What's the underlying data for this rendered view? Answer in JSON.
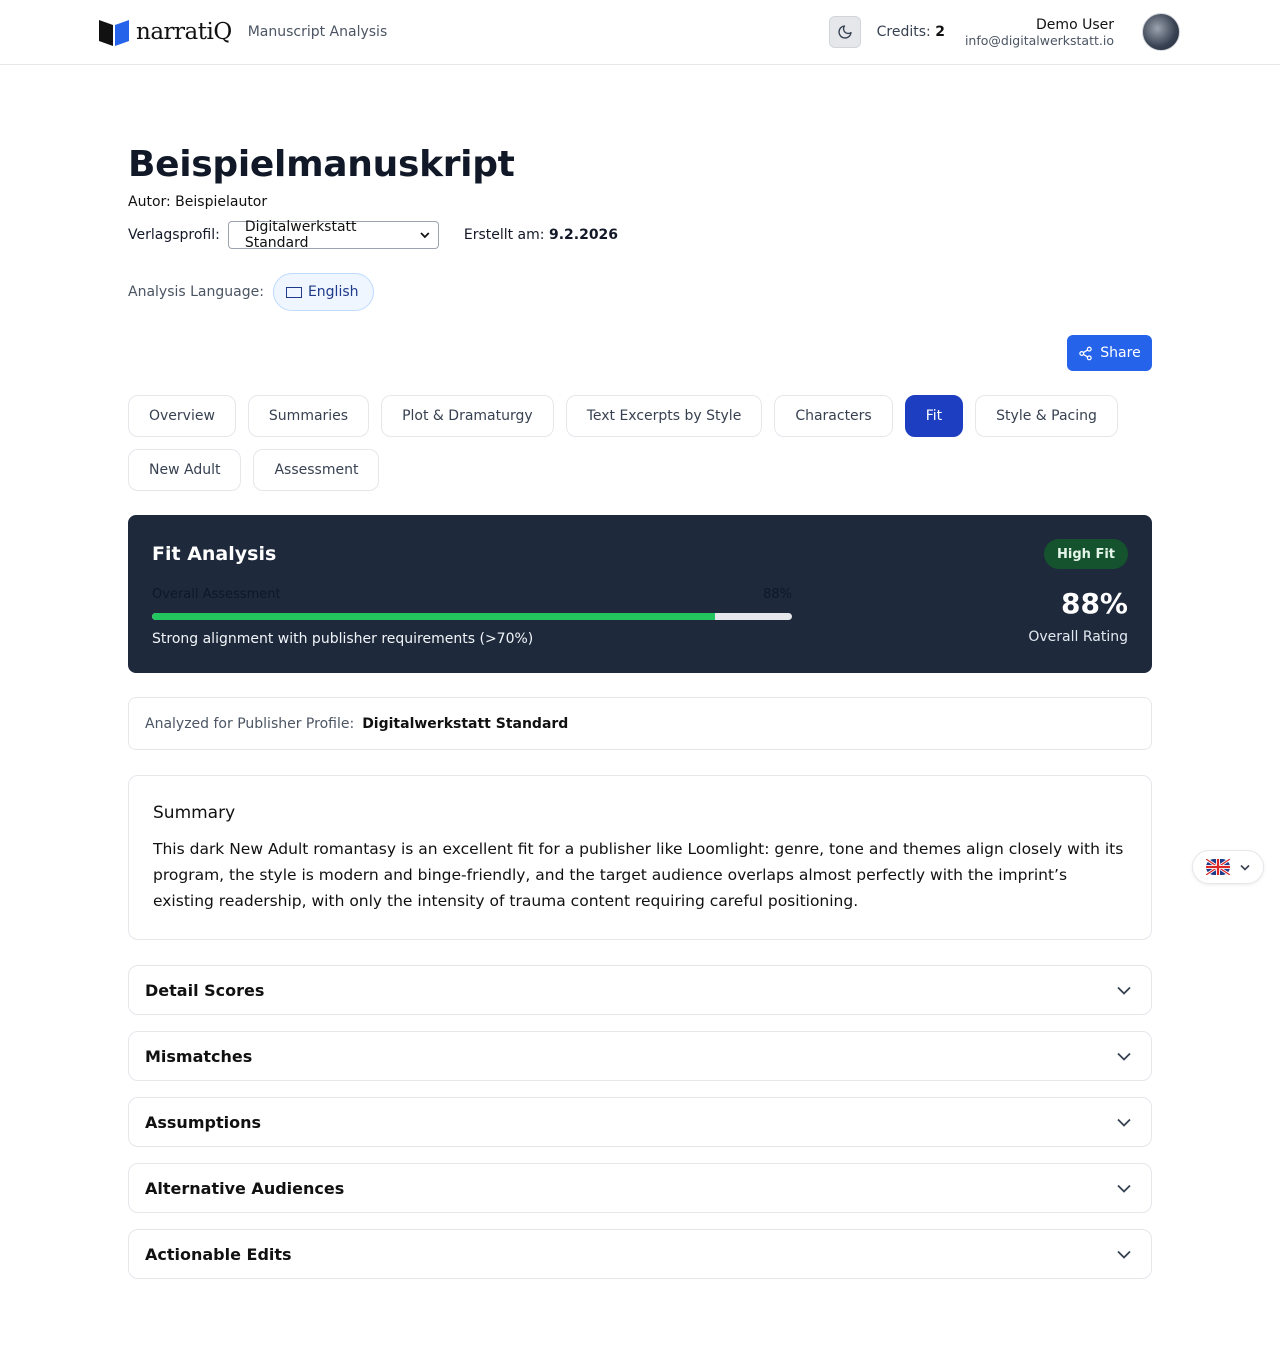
{
  "header": {
    "brand": "narratiQ",
    "subtitle": "Manuscript Analysis",
    "credits_label": "Credits:",
    "credits_value": "2",
    "user_name": "Demo User",
    "user_email": "info@digitalwerkstatt.io"
  },
  "manuscript": {
    "title": "Beispielmanuskript",
    "author": "Autor: Beispielautor",
    "profile_label": "Verlagsprofil:",
    "profile_value": "Digitalwerkstatt Standard",
    "created_label": "Erstellt am:",
    "created_value": "9.2.2026",
    "language_label": "Analysis Language:",
    "language_value": "English"
  },
  "share_label": "Share",
  "tabs": [
    {
      "label": "Overview"
    },
    {
      "label": "Summaries"
    },
    {
      "label": "Plot & Dramaturgy"
    },
    {
      "label": "Text Excerpts by Style"
    },
    {
      "label": "Characters"
    },
    {
      "label": "Fit",
      "active": true
    },
    {
      "label": "Style & Pacing"
    },
    {
      "label": "New Adult"
    },
    {
      "label": "Assessment"
    }
  ],
  "fit": {
    "title": "Fit Analysis",
    "badge": "High Fit",
    "bar_label": "Overall Assessment",
    "bar_value_text": "88%",
    "progress": 0.88,
    "note": "Strong alignment with publisher requirements (>70%)",
    "big_value": "88%",
    "big_label": "Overall Rating"
  },
  "profile": {
    "label": "Analyzed for Publisher Profile:",
    "value": "Digitalwerkstatt Standard"
  },
  "summary": {
    "title": "Summary",
    "text": "This dark New Adult romantasy is an excellent fit for a publisher like Loomlight: genre, tone and themes align closely with its program, the style is modern and binge-friendly, and the target audience overlaps almost perfectly with the imprint’s existing readership, with only the intensity of trauma content requiring careful positioning."
  },
  "sections": [
    {
      "title": "Detail Scores"
    },
    {
      "title": "Mismatches"
    },
    {
      "title": "Assumptions"
    },
    {
      "title": "Alternative Audiences"
    },
    {
      "title": "Actionable Edits"
    }
  ],
  "colors": {
    "accent": "#2563eb",
    "tab_active": "#1d3ec0",
    "card_dark": "#1e293b",
    "progress": "#22c55e"
  }
}
